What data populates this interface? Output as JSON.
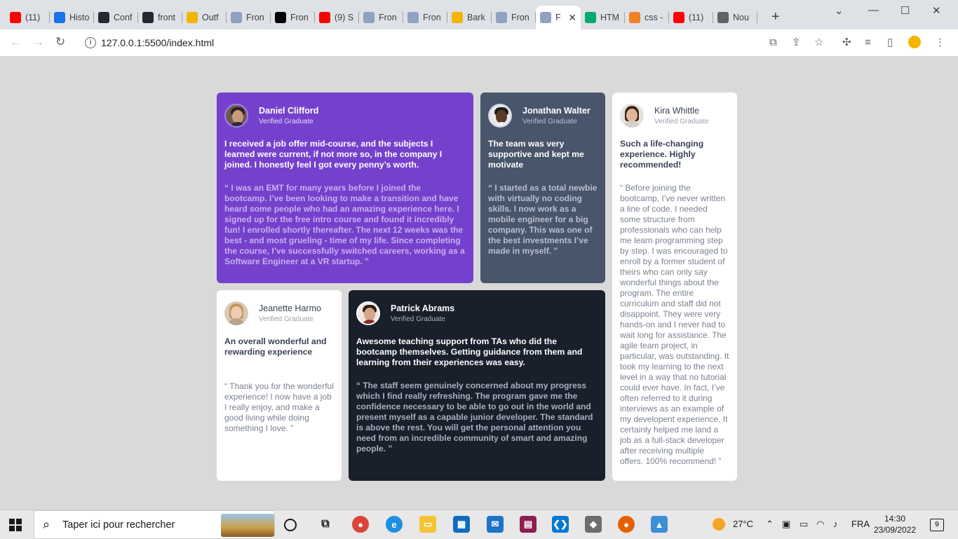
{
  "browser": {
    "tabs": [
      {
        "title": "(11)",
        "icon": "youtube-icon",
        "color": "#ff0000"
      },
      {
        "title": "Histo",
        "icon": "history-icon",
        "color": "#1a73e8"
      },
      {
        "title": "Conf",
        "icon": "github-icon",
        "color": "#24292f"
      },
      {
        "title": "front",
        "icon": "github-icon",
        "color": "#24292f"
      },
      {
        "title": "Outf",
        "icon": "outfit-icon",
        "color": "#f4b400"
      },
      {
        "title": "Fron",
        "icon": "frontend-mentor-icon",
        "color": "#8fa2c4"
      },
      {
        "title": "Fron",
        "icon": "dev-icon",
        "color": "#000000"
      },
      {
        "title": "(9) S",
        "icon": "youtube-icon",
        "color": "#ff0000"
      },
      {
        "title": "Fron",
        "icon": "frontend-mentor-icon",
        "color": "#8fa2c4"
      },
      {
        "title": "Fron",
        "icon": "frontend-mentor-icon",
        "color": "#8fa2c4"
      },
      {
        "title": "Bark",
        "icon": "barlow-icon",
        "color": "#f4b400"
      },
      {
        "title": "Fron",
        "icon": "frontend-mentor-icon",
        "color": "#8fa2c4"
      },
      {
        "title": "F",
        "icon": "frontend-mentor-icon",
        "color": "#8fa2c4",
        "active": true
      },
      {
        "title": "HTM",
        "icon": "w3schools-icon",
        "color": "#04aa6d"
      },
      {
        "title": "css -",
        "icon": "stackoverflow-icon",
        "color": "#f48024"
      },
      {
        "title": "(11)",
        "icon": "youtube-icon",
        "color": "#ff0000"
      },
      {
        "title": "Nou",
        "icon": "chrome-icon",
        "color": "#5f6368"
      }
    ],
    "new_tab": "+",
    "url": "127.0.0.1:5500/index.html"
  },
  "testimonials": {
    "daniel": {
      "name": "Daniel Clifford",
      "role": "Verified Graduate",
      "summary": "I received a job offer mid-course, and the subjects I learned were current, if not more so, in the company I joined. I honestly feel I got every penny’s worth.",
      "quote": "“ I was an EMT for many years before I joined the bootcamp. I’ve been looking to make a transition and have heard some people who had an amazing experience here. I signed up for the free intro course and found it incredibly fun! I enrolled shortly thereafter. The next 12 weeks was the best - and most grueling - time of my life. Since completing the course, I’ve successfully switched careers, working as a Software Engineer at a VR startup. ”"
    },
    "jonathan": {
      "name": "Jonathan Walter",
      "role": "Verified Graduate",
      "summary": "The team was very supportive and kept me motivate",
      "quote": "“ I started as a total newbie with virtually no coding skills. I now work as a mobile engineer for a big company. This was one of the best investments I’ve made in myself. ”"
    },
    "kira": {
      "name": "Kira Whittle",
      "role": "Verified Graduate",
      "summary": "Such a life-changing experience. Highly recommended!",
      "quote": "“ Before joining the bootcamp, I’ve never written a line of code. I needed some structure from professionals who can help me learn programming step by step. I was encouraged to enroll by a former student of theirs who can only say wonderful things about the program. The entire curriculum and staff did not disappoint. They were very hands-on and I never had to wait long for assistance. The agile team project, in particular, was outstanding. It took my learning to the next level in a way that no tutorial could ever have. In fact, I’ve often referred to it during interviews as an example of my developent experience. It certainly helped me land a job as a full-stack developer after receiving multiple offers. 100% recommend! ”"
    },
    "jeanette": {
      "name": "Jeanette Harmo",
      "role": "Verified Graduate",
      "summary": "An overall wonderful and rewarding experience",
      "quote": "“ Thank you for the wonderful experience! I now have a job I really enjoy, and make a good living while doing something I love. ”"
    },
    "patrick": {
      "name": "Patrick Abrams",
      "role": "Verified Graduate",
      "summary": "Awesome teaching support from TAs who did the bootcamp themselves. Getting guidance from them and learning from their experiences was easy.",
      "quote": "“ The staff seem genuinely concerned about my progress which I find really refreshing. The program gave me the confidence necessary to be able to go out in the world and present myself as a capable junior developer. The standard is above the rest. You will get the personal attention you need from an incredible community of smart and amazing people. ”"
    }
  },
  "taskbar": {
    "search_placeholder": "Taper ici pour rechercher",
    "weather": "27°C",
    "language": "FRA",
    "time": "14:30",
    "date": "23/09/2022",
    "notification_count": "9"
  },
  "colors": {
    "purple_card": "#7441cc",
    "slate_card": "#48556a",
    "dark_card": "#1a1f2c",
    "page_background": "#d9d9d9"
  }
}
